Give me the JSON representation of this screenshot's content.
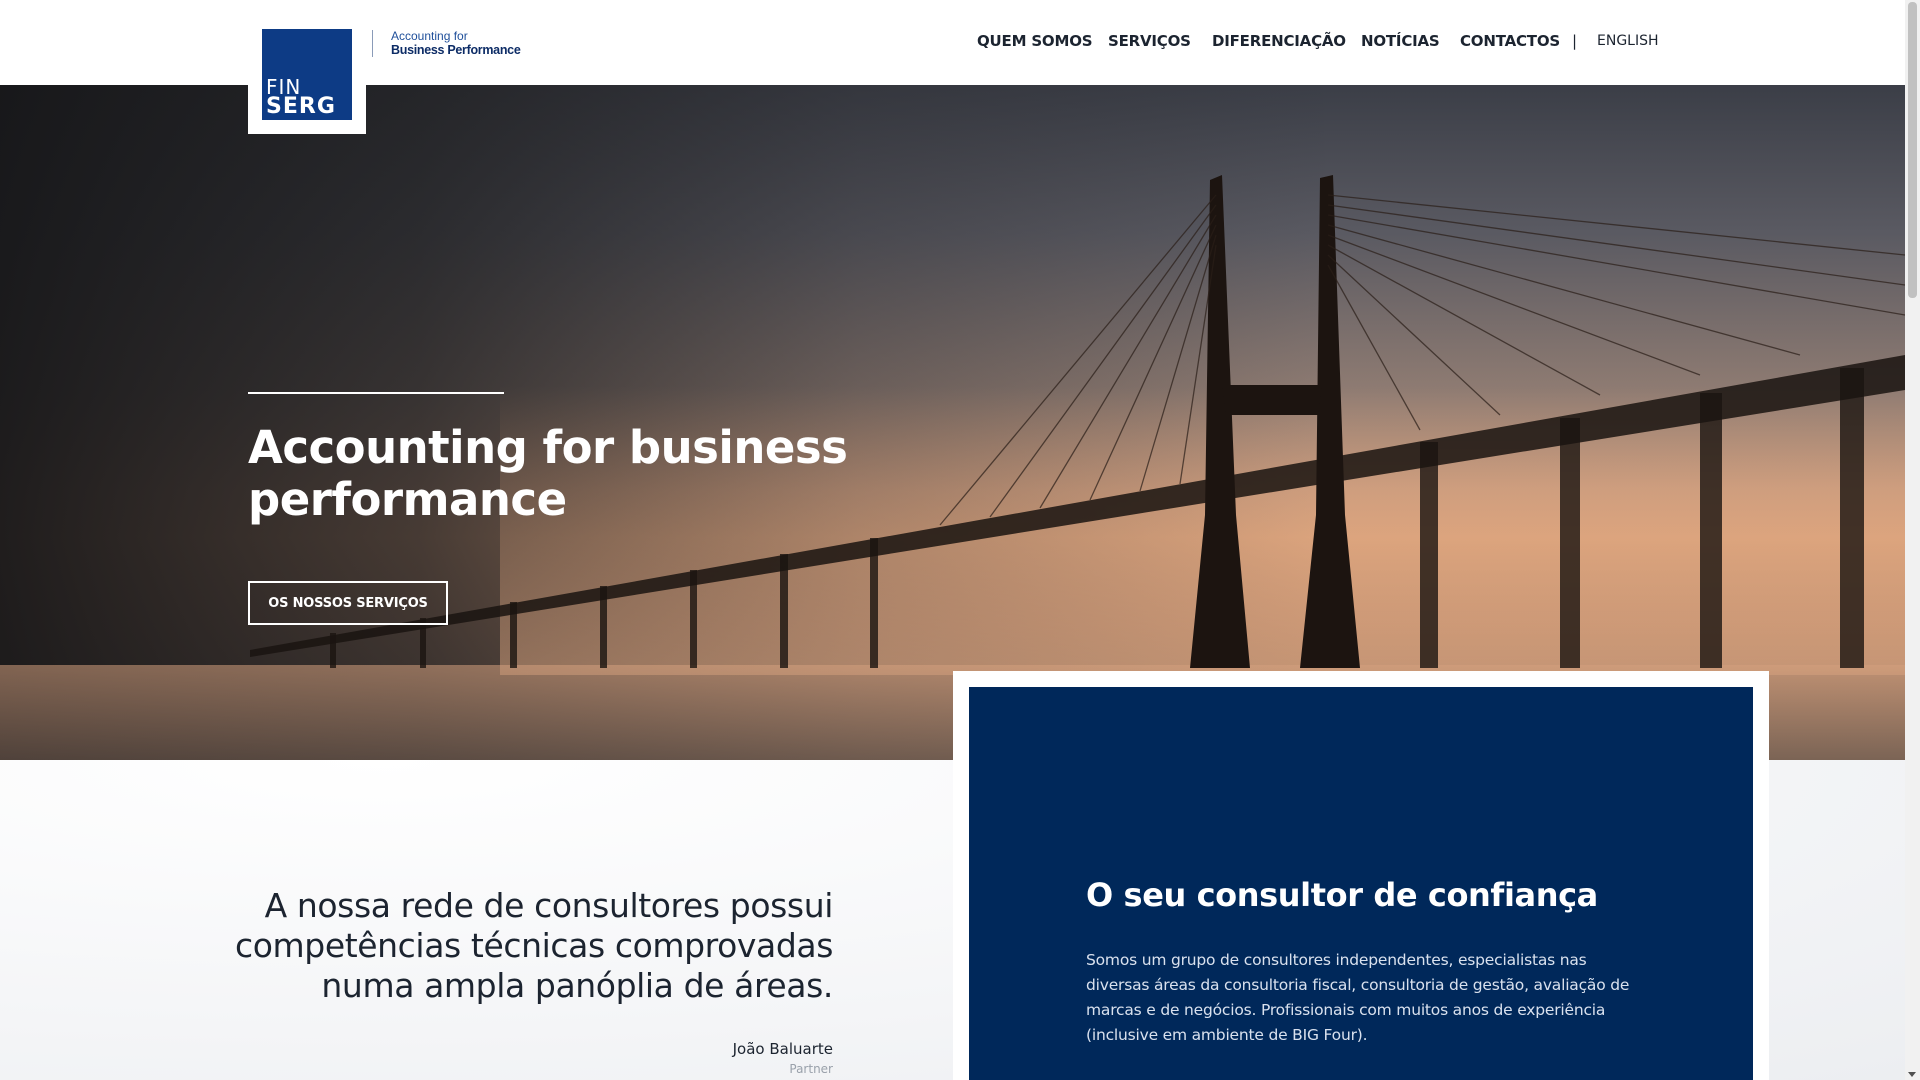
{
  "brand": {
    "logo_line1": "FIN",
    "logo_line2": "SERG",
    "tagline_line1": "Accounting for",
    "tagline_line2": "Business Performance",
    "colors": {
      "logo_blue": "#0d3b85",
      "card_navy": "#00285a"
    }
  },
  "nav": {
    "items": [
      "QUEM SOMOS",
      "SERVIÇOS",
      "DIFERENCIAÇÃO",
      "NOTÍCIAS",
      "CONTACTOS"
    ],
    "separator": "|",
    "language": "ENGLISH"
  },
  "hero": {
    "title": "Accounting for business performance",
    "button_label": "OS NOSSOS SERVIÇOS"
  },
  "quote": {
    "text": "A nossa rede de consultores possui competências técnicas comprovadas numa ampla panóplia de áreas.",
    "author": "João Baluarte",
    "role": "Partner"
  },
  "card": {
    "title": "O seu consultor de confiança",
    "body": "Somos um grupo de consultores independentes, especialistas nas diversas áreas da consultoria fiscal, consultoria de gestão, avaliação de marcas e de negócios. Profissionais com muitos anos de experiência (inclusive em ambiente de BIG Four)."
  }
}
